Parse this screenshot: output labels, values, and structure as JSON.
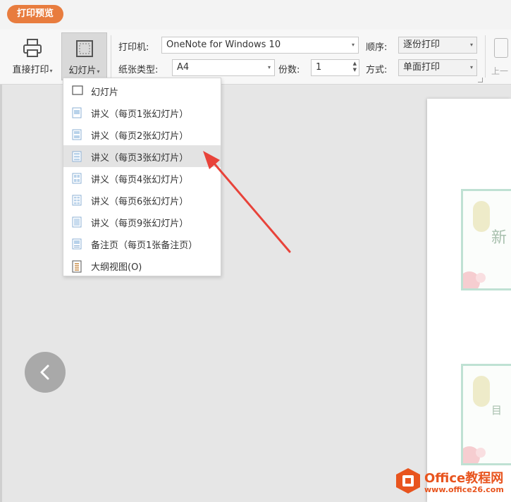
{
  "tab": {
    "label": "打印预览"
  },
  "toolbar": {
    "direct_print": "直接打印",
    "slides": "幻灯片",
    "printer_label": "打印机:",
    "printer_value": "OneNote for Windows 10",
    "paper_label": "纸张类型:",
    "paper_value": "A4",
    "copies_label": "份数:",
    "copies_value": "1",
    "order_label": "顺序:",
    "order_value": "逐份打印",
    "mode_label": "方式:",
    "mode_value": "单面打印",
    "prev_page": "上一"
  },
  "menu": {
    "items": [
      {
        "label": "幻灯片",
        "icon": "slide-icon"
      },
      {
        "label": "讲义（每页1张幻灯片）",
        "icon": "handout-1-icon"
      },
      {
        "label": "讲义（每页2张幻灯片）",
        "icon": "handout-2-icon"
      },
      {
        "label": "讲义（每页3张幻灯片）",
        "icon": "handout-3-icon",
        "highlighted": true
      },
      {
        "label": "讲义（每页4张幻灯片）",
        "icon": "handout-4-icon"
      },
      {
        "label": "讲义（每页6张幻灯片）",
        "icon": "handout-6-icon"
      },
      {
        "label": "讲义（每页9张幻灯片）",
        "icon": "handout-9-icon"
      },
      {
        "label": "备注页（每页1张备注页）",
        "icon": "notes-page-icon"
      },
      {
        "label": "大纲视图(O)",
        "icon": "outline-icon"
      }
    ]
  },
  "preview": {
    "thumb1_text": "新",
    "thumb2_text": "目"
  },
  "watermark": {
    "brand": "Office教程网",
    "url": "www.office26.com"
  },
  "colors": {
    "accent": "#e87c3e",
    "arrow": "#e8433a",
    "thumb_border": "#bfe1d3"
  }
}
